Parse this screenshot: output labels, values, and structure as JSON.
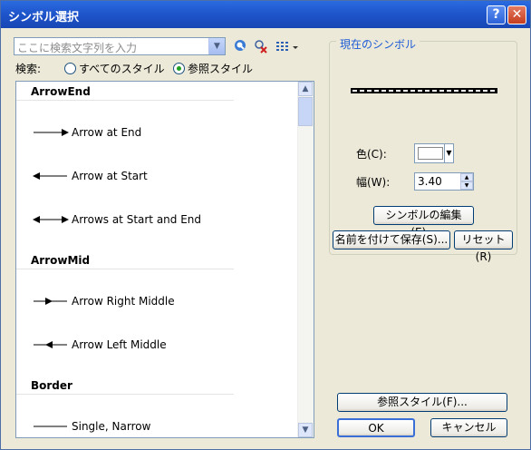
{
  "window": {
    "title": "シンボル選択",
    "help_glyph": "?",
    "close_glyph": "✕"
  },
  "search": {
    "placeholder": "ここに検索文字列を入力",
    "drop_glyph": "▼"
  },
  "toolbar_icons": {
    "search": "search-icon",
    "clear": "clear-search-icon",
    "view": "view-options-icon"
  },
  "filter": {
    "label": "検索:",
    "options": [
      "すべてのスタイル",
      "参照スタイル"
    ],
    "selected": "参照スタイル"
  },
  "symbols": {
    "categories": [
      {
        "name": "ArrowEnd",
        "items": [
          "Arrow at End",
          "Arrow at Start",
          "Arrows at Start and End"
        ]
      },
      {
        "name": "ArrowMid",
        "items": [
          "Arrow Right Middle",
          "Arrow Left Middle"
        ]
      },
      {
        "name": "Border",
        "items": [
          "Single, Narrow"
        ]
      }
    ],
    "scroll_up": "▲",
    "scroll_down": "▼"
  },
  "current": {
    "group_title": "現在のシンボル",
    "color_label": "色(C):",
    "color_value": "#ffffff",
    "width_label": "幅(W):",
    "width_value": "3.40",
    "edit_button": "シンボルの編集(E)...",
    "save_button": "名前を付けて保存(S)...",
    "reset_button": "リセット(R)"
  },
  "footer": {
    "styles_button": "参照スタイル(F)...",
    "ok_button": "OK",
    "cancel_button": "キャンセル"
  }
}
